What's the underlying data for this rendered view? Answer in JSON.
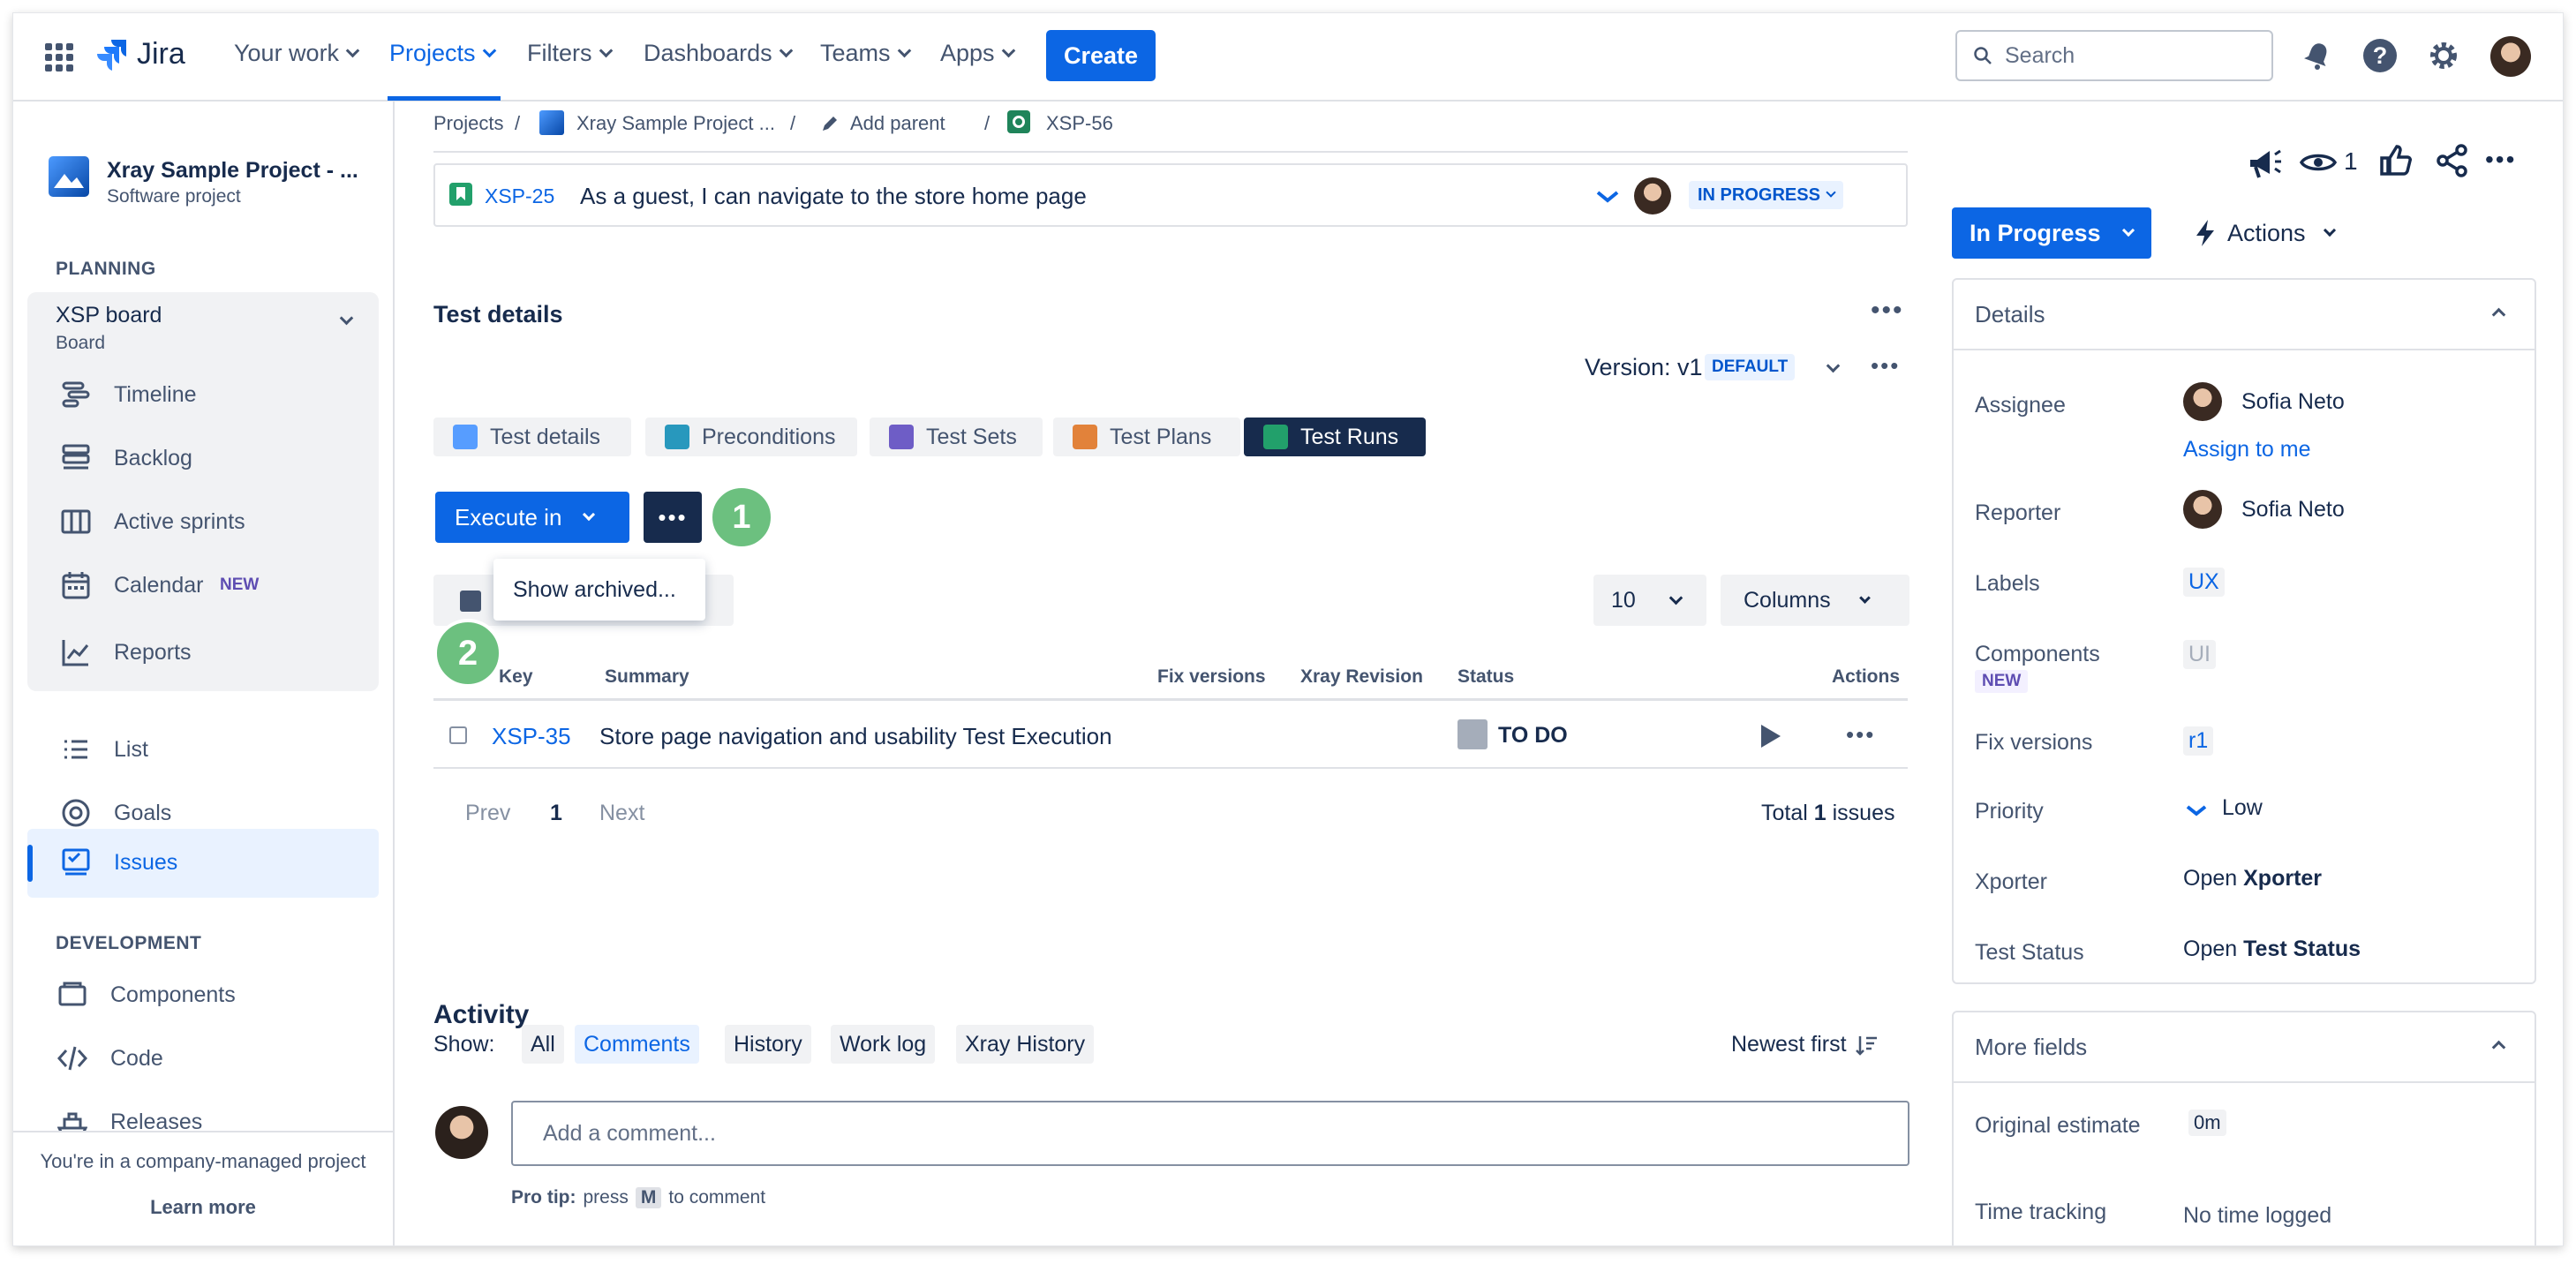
{
  "topnav": {
    "app_name": "Jira",
    "items": [
      "Your work",
      "Projects",
      "Filters",
      "Dashboards",
      "Teams",
      "Apps"
    ],
    "create_label": "Create",
    "search_placeholder": "Search"
  },
  "sidebar": {
    "project_name": "Xray Sample Project - ...",
    "project_type": "Software project",
    "planning_heading": "PLANNING",
    "board_name": "XSP board",
    "board_sub": "Board",
    "planning_items": [
      "Timeline",
      "Backlog",
      "Active sprints",
      "Calendar",
      "Reports"
    ],
    "calendar_badge": "NEW",
    "items": [
      "List",
      "Goals",
      "Issues"
    ],
    "development_heading": "DEVELOPMENT",
    "dev_items": [
      "Components",
      "Code",
      "Releases"
    ],
    "footer_text": "You're in a company-managed project",
    "learn_more": "Learn more"
  },
  "breadcrumb": {
    "projects": "Projects",
    "project": "Xray Sample Project ...",
    "add_parent": "Add parent",
    "issue_key": "XSP-56",
    "sep": "/"
  },
  "linked_issue": {
    "key": "XSP-25",
    "summary": "As a guest, I can navigate to the store home page",
    "status": "IN PROGRESS"
  },
  "test_details": {
    "heading": "Test details",
    "version_label": "Version: v1",
    "version_badge": "DEFAULT",
    "tabs": [
      "Test details",
      "Preconditions",
      "Test Sets",
      "Test Plans",
      "Test Runs"
    ],
    "execute_label": "Execute in",
    "menu_item": "Show archived...",
    "callout_1": "1",
    "callout_2": "2",
    "page_size": "10",
    "columns_label": "Columns",
    "headers": {
      "key": "Key",
      "summary": "Summary",
      "fix_versions": "Fix versions",
      "xray_revision": "Xray Revision",
      "status": "Status",
      "actions": "Actions"
    },
    "rows": [
      {
        "key": "XSP-35",
        "summary": "Store page navigation and usability Test Execution",
        "status": "TO DO"
      }
    ],
    "pagination": {
      "prev": "Prev",
      "page": "1",
      "next": "Next",
      "total_prefix": "Total ",
      "total_count": "1",
      "total_suffix": " issues"
    }
  },
  "activity": {
    "heading": "Activity",
    "show_label": "Show:",
    "tabs": [
      "All",
      "Comments",
      "History",
      "Work log",
      "Xray History"
    ],
    "sort_label": "Newest first",
    "comment_placeholder": "Add a comment...",
    "pro_tip_bold": "Pro tip:",
    "pro_tip_1": "press",
    "pro_tip_key": "M",
    "pro_tip_2": "to comment"
  },
  "right_panel": {
    "watch_count": "1",
    "status_button": "In Progress",
    "actions_label": "Actions",
    "details_heading": "Details",
    "assignee_label": "Assignee",
    "assignee": "Sofia Neto",
    "assign_to_me": "Assign to me",
    "reporter_label": "Reporter",
    "reporter": "Sofia Neto",
    "labels_label": "Labels",
    "labels_value": "UX",
    "components_label": "Components",
    "components_badge": "NEW",
    "components_value": "UI",
    "fix_versions_label": "Fix versions",
    "fix_versions_value": "r1",
    "priority_label": "Priority",
    "priority_value": "Low",
    "xporter_label": "Xporter",
    "xporter_open": "Open",
    "xporter_value": "Xporter",
    "test_status_label": "Test Status",
    "test_status_open": "Open",
    "test_status_value": "Test Status",
    "more_fields_heading": "More fields",
    "original_estimate_label": "Original estimate",
    "original_estimate_value": "0m",
    "time_tracking_label": "Time tracking",
    "time_tracking_value": "No time logged"
  },
  "colors": {
    "brand": "#0c66e4",
    "callout": "#6cc07f",
    "dark": "#172b4d"
  }
}
